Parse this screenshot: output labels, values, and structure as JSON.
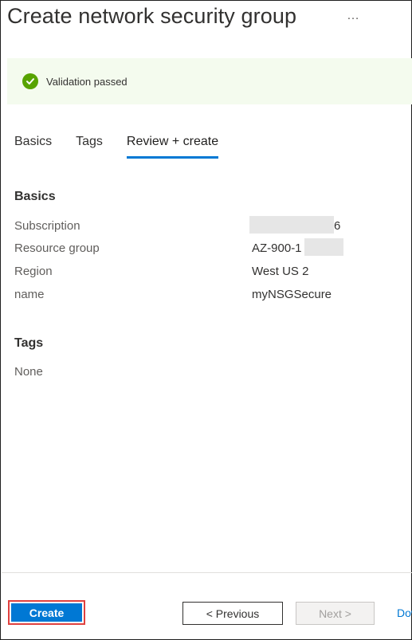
{
  "header": {
    "title": "Create network security group",
    "more_label": "…"
  },
  "banner": {
    "message": "Validation passed",
    "status_color": "#57a300"
  },
  "tabs": [
    {
      "label": "Basics",
      "active": false
    },
    {
      "label": "Tags",
      "active": false
    },
    {
      "label": "Review + create",
      "active": true
    }
  ],
  "basics": {
    "heading": "Basics",
    "rows": [
      {
        "label": "Subscription",
        "value": "6"
      },
      {
        "label": "Resource group",
        "value": "AZ-900-1"
      },
      {
        "label": "Region",
        "value": "West US 2"
      },
      {
        "label": "name",
        "value": "myNSGSecure"
      }
    ]
  },
  "tags": {
    "heading": "Tags",
    "value": "None"
  },
  "footer": {
    "create_label": "Create",
    "previous_label": "< Previous",
    "next_label": "Next >",
    "download_label": "Download a template for automation",
    "accent_color": "#0078d4",
    "highlight_color": "#e0413f"
  }
}
